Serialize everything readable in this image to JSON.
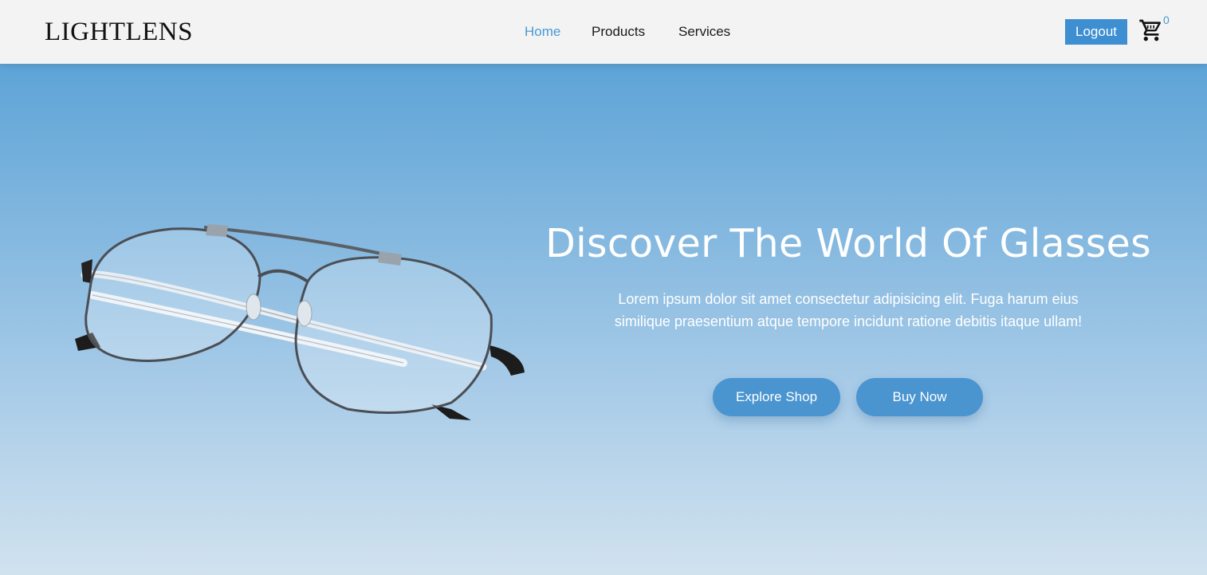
{
  "brand": {
    "name": "LIGHTLENS"
  },
  "nav": {
    "items": [
      {
        "label": "Home"
      },
      {
        "label": "Products"
      },
      {
        "label": "Services"
      }
    ]
  },
  "header": {
    "logout_label": "Logout",
    "cart_icon": "shopping-cart-icon",
    "cart_count": "0"
  },
  "hero": {
    "title": "Discover The World Of Glasses",
    "description": "Lorem ipsum dolor sit amet consectetur adipisicing elit. Fuga harum eius similique praesentium atque tempore incidunt ratione debitis itaque ullam!",
    "primary_button": "Explore Shop",
    "secondary_button": "Buy Now"
  },
  "colors": {
    "accent": "#4a9ad4",
    "button": "#4a94d0",
    "navbar_bg": "#f3f3f3",
    "hero_top": "#5ea4d7",
    "hero_bottom": "#d1e2ee"
  }
}
